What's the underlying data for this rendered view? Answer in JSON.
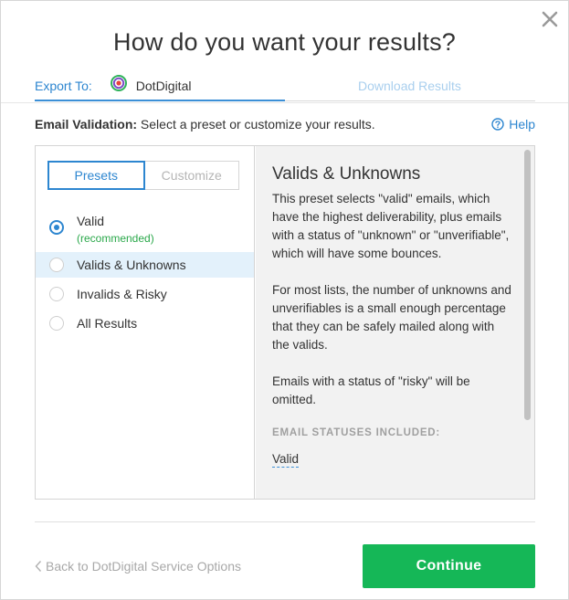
{
  "dialog": {
    "title": "How do you want your results?",
    "close_icon": "close-icon"
  },
  "tabs": {
    "export_label": "Export To:",
    "provider_name": "DotDigital",
    "provider_logo_icon": "dotdigital-logo-icon",
    "download_label": "Download Results"
  },
  "validation": {
    "label": "Email Validation:",
    "description": " Select a preset or customize your results.",
    "help_label": "Help",
    "help_icon": "question-circle-icon"
  },
  "segmented": {
    "presets_label": "Presets",
    "customize_label": "Customize",
    "active": "Presets"
  },
  "options": [
    {
      "label": "Valid",
      "sublabel": "(recommended)",
      "selected": true,
      "highlighted": false
    },
    {
      "label": "Valids & Unknowns",
      "selected": false,
      "highlighted": true
    },
    {
      "label": "Invalids & Risky",
      "selected": false,
      "highlighted": false
    },
    {
      "label": "All Results",
      "selected": false,
      "highlighted": false
    }
  ],
  "detail": {
    "heading": "Valids & Unknowns",
    "para1": "This preset selects \"valid\" emails, which have the highest deliverability, plus emails with a status of \"unknown\" or \"unverifiable\", which will have some bounces.",
    "para2": "For most lists, the number of unknowns and unverifiables is a small enough percentage that they can be safely mailed along with the valids.",
    "para3": "Emails with a status of \"risky\" will be omitted.",
    "statuses_header": "EMAIL STATUSES INCLUDED:",
    "statuses": [
      "Valid"
    ]
  },
  "footer": {
    "back_label": "Back to DotDigital Service Options",
    "back_icon": "chevron-left-icon",
    "continue_label": "Continue"
  },
  "colors": {
    "accent": "#2d86d0",
    "success": "#15b757",
    "recommended": "#2aa84a",
    "highlight_row": "#e3f1fb"
  }
}
